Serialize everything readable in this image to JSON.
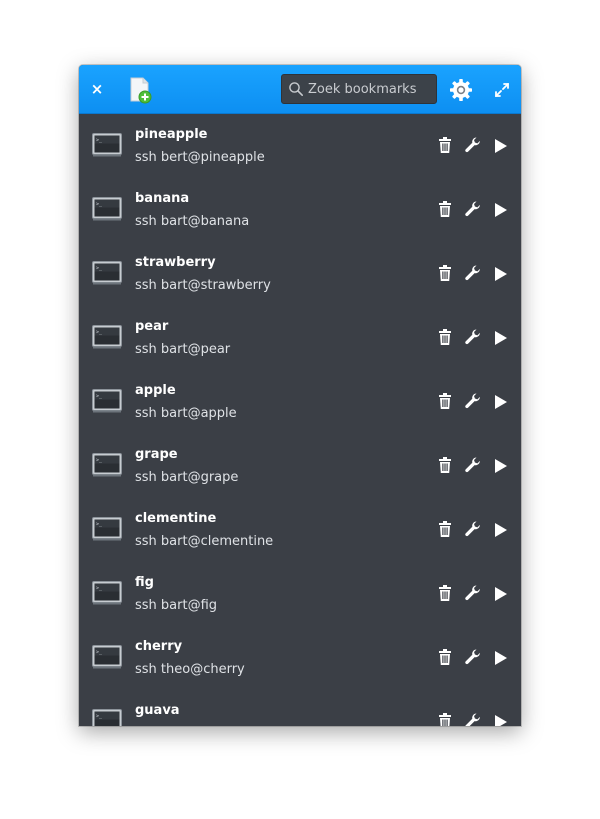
{
  "header": {
    "close_glyph": "×",
    "search_placeholder": "Zoek bookmarks",
    "search_value": ""
  },
  "icons": {
    "close": "close-icon",
    "new_bookmark": "new-document-icon",
    "search": "search-icon",
    "settings": "gear-icon",
    "expand": "expand-icon",
    "terminal": "terminal-icon",
    "delete": "trash-icon",
    "edit": "wrench-icon",
    "connect": "play-icon"
  },
  "colors": {
    "header_accent": "#0d8ff2",
    "list_background": "#3b3f46"
  },
  "bookmarks": [
    {
      "name": "pineapple",
      "command": "ssh bert@pineapple"
    },
    {
      "name": "banana",
      "command": "ssh bart@banana"
    },
    {
      "name": "strawberry",
      "command": "ssh bart@strawberry"
    },
    {
      "name": "pear",
      "command": "ssh bart@pear"
    },
    {
      "name": "apple",
      "command": "ssh bart@apple"
    },
    {
      "name": "grape",
      "command": "ssh bart@grape"
    },
    {
      "name": "clementine",
      "command": "ssh bart@clementine"
    },
    {
      "name": "fig",
      "command": "ssh bart@fig"
    },
    {
      "name": "cherry",
      "command": "ssh theo@cherry"
    },
    {
      "name": "guava",
      "command": ""
    }
  ]
}
